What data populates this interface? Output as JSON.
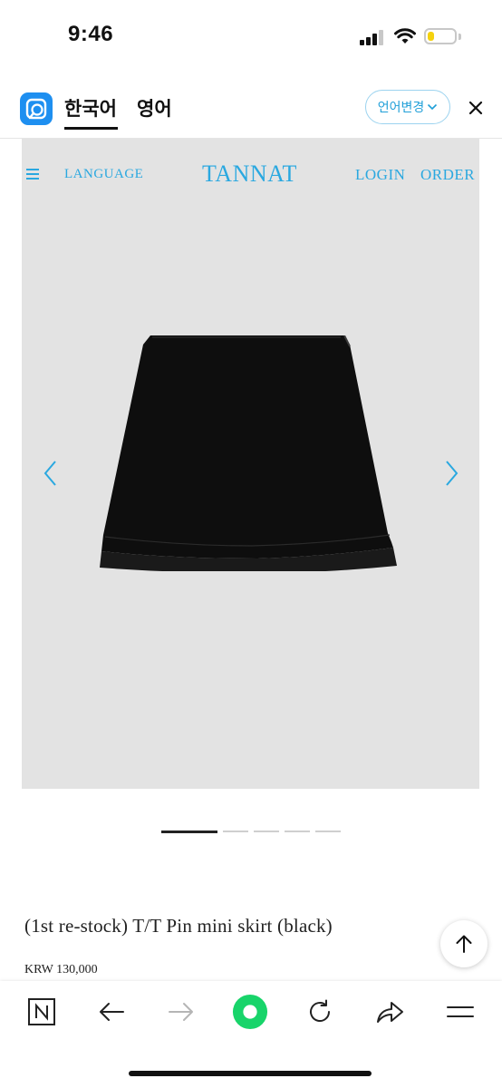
{
  "status_bar": {
    "time": "9:46",
    "battery_level": 0.25,
    "battery_color": "#f5d20e"
  },
  "translate_bar": {
    "logo_icon": "papago-icon",
    "source_lang": "한국어",
    "target_lang": "영어",
    "change_button": "언어변경",
    "change_icon": "chevron-down-icon",
    "close_icon": "close-icon",
    "accent_color": "#1f9fd8"
  },
  "site_nav": {
    "menu_icon": "hamburger-icon",
    "language": "LANGUAGE",
    "logo": "TANNAT",
    "login": "LOGIN",
    "order": "ORDER",
    "brand_color": "#2aa8e0"
  },
  "gallery": {
    "prev_icon": "chevron-left-icon",
    "next_icon": "chevron-right-icon",
    "image": "black mini skirt product photo",
    "slide_count": 5,
    "active_slide": 1
  },
  "product": {
    "title": "(1st re-stock) T/T Pin mini skirt (black)",
    "price": "KRW 130,000"
  },
  "scroll_top_icon": "arrow-up-icon",
  "toolbar": {
    "items": [
      "naver-n-icon",
      "back-arrow-icon",
      "forward-arrow-icon",
      "green-dot-icon",
      "refresh-icon",
      "share-icon",
      "menu-lines-icon"
    ],
    "green_color": "#18d46a"
  }
}
